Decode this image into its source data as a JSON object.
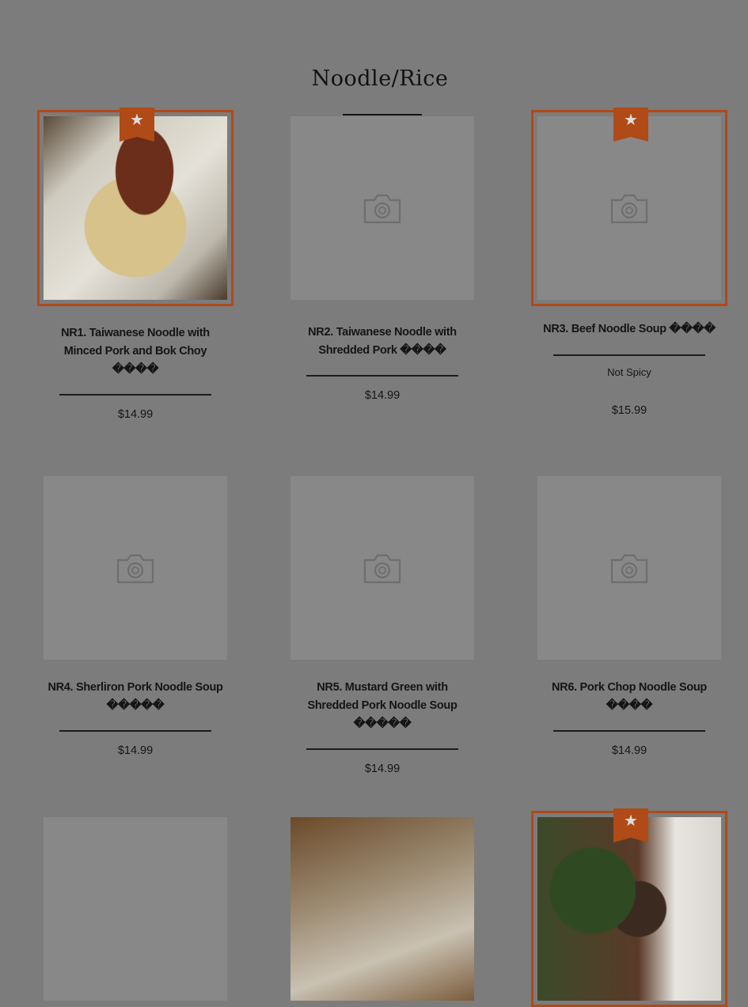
{
  "section": {
    "title": "Noodle/Rice"
  },
  "icons": {
    "placeholder": "camera-icon",
    "featured": "star-icon"
  },
  "colors": {
    "featured_accent": "#b04a17",
    "background": "#7c7c7c",
    "placeholder_fill": "#888888"
  },
  "items": [
    {
      "name": "NR1. Taiwanese Noodle with Minced Pork and Bok Choy ����",
      "price": "$14.99",
      "featured": true,
      "image": "photo"
    },
    {
      "name": "NR2. Taiwanese Noodle with Shredded Pork ����",
      "price": "$14.99",
      "featured": false,
      "image": "placeholder"
    },
    {
      "name": "NR3. Beef Noodle Soup ����",
      "note": "Not Spicy",
      "price": "$15.99",
      "featured": true,
      "image": "placeholder"
    },
    {
      "name": "NR4. Sherliron Pork Noodle Soup �����",
      "price": "$14.99",
      "featured": false,
      "image": "placeholder"
    },
    {
      "name": "NR5. Mustard Green with Shredded Pork Noodle Soup �����",
      "price": "$14.99",
      "featured": false,
      "image": "placeholder"
    },
    {
      "name": "NR6. Pork Chop Noodle Soup ����",
      "price": "$14.99",
      "featured": false,
      "image": "placeholder"
    },
    {
      "featured": false,
      "image": "placeholder"
    },
    {
      "featured": false,
      "image": "photo"
    },
    {
      "featured": true,
      "image": "photo"
    }
  ]
}
